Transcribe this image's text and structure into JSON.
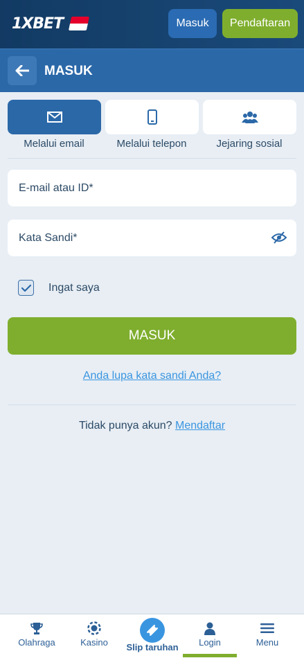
{
  "header": {
    "logo_text": "1XBET",
    "login_button": "Masuk",
    "register_button": "Pendaftaran"
  },
  "titlebar": {
    "title": "MASUK"
  },
  "tabs": [
    {
      "label": "Melalui email",
      "icon": "envelope-icon",
      "active": true
    },
    {
      "label": "Melalui telepon",
      "icon": "phone-icon",
      "active": false
    },
    {
      "label": "Jejaring sosial",
      "icon": "users-icon",
      "active": false
    }
  ],
  "form": {
    "email_placeholder": "E-mail atau ID*",
    "password_placeholder": "Kata Sandi*",
    "remember_label": "Ingat saya",
    "remember_checked": true,
    "submit_label": "MASUK",
    "forgot_link": "Anda lupa kata sandi Anda?",
    "no_account_text": "Tidak punya akun?",
    "register_link": "Mendaftar"
  },
  "bottom_nav": {
    "items": [
      {
        "label": "Olahraga",
        "icon": "trophy-icon"
      },
      {
        "label": "Kasino",
        "icon": "casino-chip-icon"
      },
      {
        "label": "Slip taruhan",
        "icon": "ticket-icon"
      },
      {
        "label": "Login",
        "icon": "user-icon"
      },
      {
        "label": "Menu",
        "icon": "hamburger-icon"
      }
    ]
  },
  "colors": {
    "header_bg": "#123a63",
    "title_bg": "#2b68a8",
    "accent_green": "#7fae2e",
    "link_blue": "#3a95e0",
    "page_bg": "#e8eef4"
  }
}
